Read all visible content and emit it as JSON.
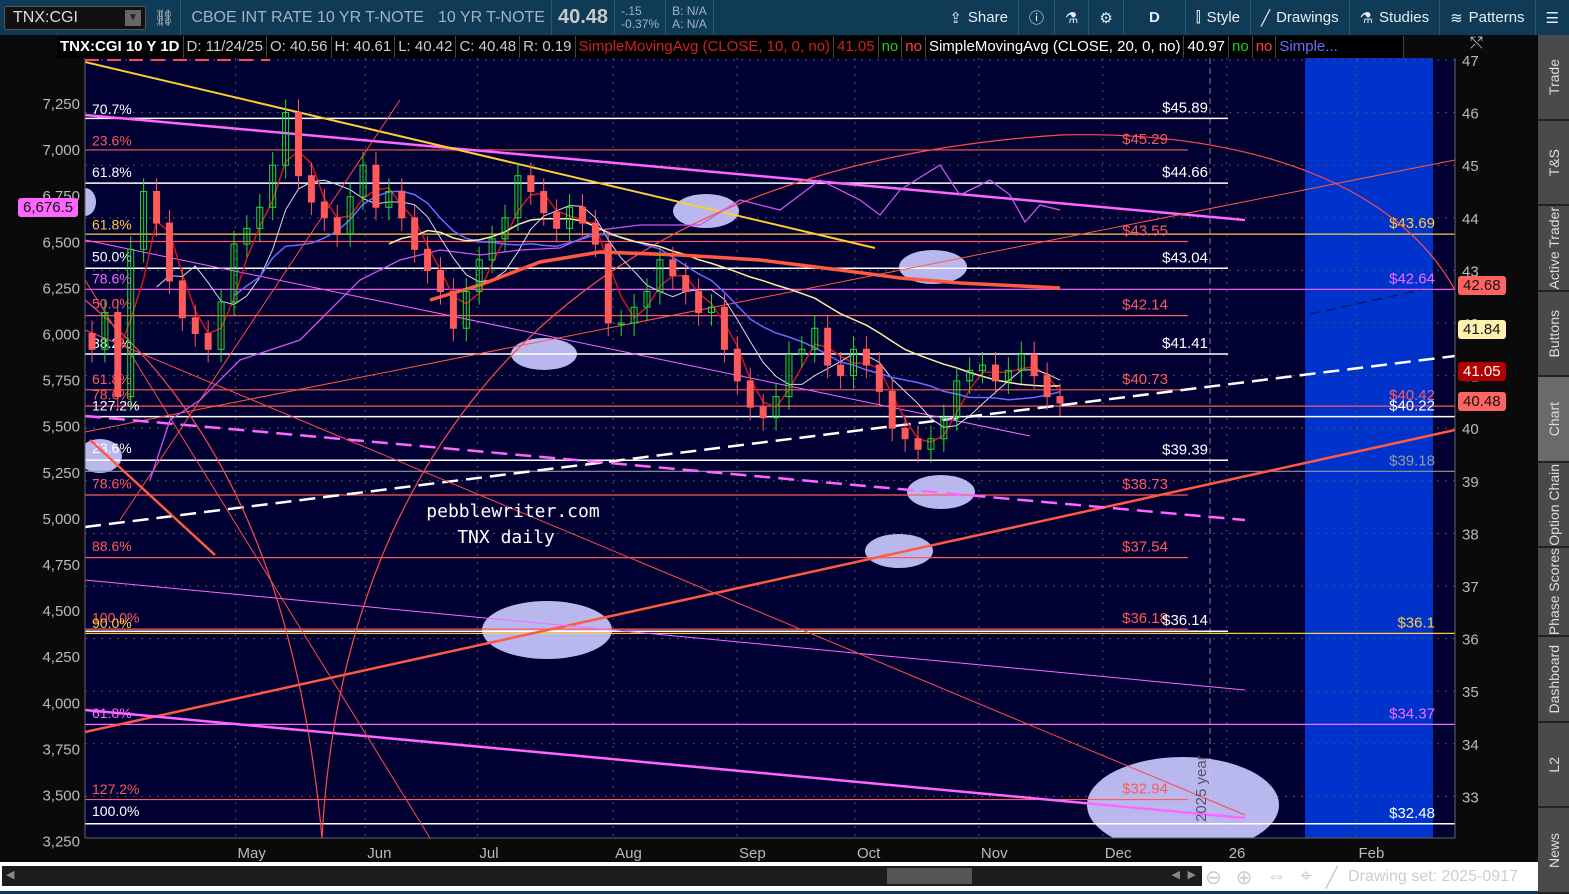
{
  "toolbar": {
    "symbol": "TNX:CGI",
    "description": "CBOE INT RATE 10 YR T-NOTE",
    "short_name": "10 YR T-NOTE",
    "last": "40.48",
    "change": "-.15",
    "change_pct": "-0.37%",
    "bid": "B: N/A",
    "ask": "A: N/A",
    "share": "Share",
    "period": "D",
    "style": "Style",
    "drawings": "Drawings",
    "studies": "Studies",
    "patterns": "Patterns"
  },
  "info": {
    "title": "TNX:CGI 10 Y 1D",
    "date": "D: 11/24/25",
    "open": "O: 40.56",
    "high": "H: 40.61",
    "low": "L: 40.42",
    "close": "C: 40.48",
    "range": "R: 0.19",
    "sma1": "SimpleMovingAvg (CLOSE, 10, 0, no)",
    "sma1_val": "41.05",
    "sma1_a": "no",
    "sma1_b": "no",
    "sma2": "SimpleMovingAvg (CLOSE, 20, 0, no)",
    "sma2_val": "40.97",
    "sma2_a": "no",
    "sma2_b": "no",
    "sma3": "Simple..."
  },
  "colors": {
    "bg": "#000033",
    "white": "#ffffff",
    "red": "#ff5a5a",
    "yellow": "#ffcc33",
    "magenta": "#ff66ff",
    "band": "#0033cc"
  },
  "right_axis": [
    47,
    46,
    45,
    44,
    43,
    42,
    41,
    40,
    39,
    38,
    37,
    36,
    35,
    34,
    33
  ],
  "left_axis": [
    {
      "label": "7,250",
      "v": 7250
    },
    {
      "label": "7,000",
      "v": 7000
    },
    {
      "label": "6,750",
      "v": 6750
    },
    {
      "label": "6,500",
      "v": 6500
    },
    {
      "label": "6,250",
      "v": 6250
    },
    {
      "label": "6,000",
      "v": 6000
    },
    {
      "label": "5,750",
      "v": 5750
    },
    {
      "label": "5,500",
      "v": 5500
    },
    {
      "label": "5,250",
      "v": 5250
    },
    {
      "label": "5,000",
      "v": 5000
    },
    {
      "label": "4,750",
      "v": 4750
    },
    {
      "label": "4,500",
      "v": 4500
    },
    {
      "label": "4,250",
      "v": 4250
    },
    {
      "label": "4,000",
      "v": 4000
    },
    {
      "label": "3,750",
      "v": 3750
    },
    {
      "label": "3,500",
      "v": 3500
    },
    {
      "label": "3,250",
      "v": 3250
    }
  ],
  "months": [
    {
      "label": "May",
      "day": 25
    },
    {
      "label": "Jun",
      "day": 47
    },
    {
      "label": "Jul",
      "day": 66
    },
    {
      "label": "Aug",
      "day": 89
    },
    {
      "label": "Sep",
      "day": 110
    },
    {
      "label": "Oct",
      "day": 130
    },
    {
      "label": "Nov",
      "day": 151
    },
    {
      "label": "Dec",
      "day": 172
    },
    {
      "label": "26",
      "day": 193
    },
    {
      "label": "Feb",
      "day": 215
    }
  ],
  "levels": [
    {
      "p": 45.89,
      "label": "$45.89",
      "c": "white",
      "zone": "a"
    },
    {
      "p": 45.29,
      "label": "$45.29",
      "c": "red",
      "zone": "b"
    },
    {
      "p": 44.66,
      "label": "$44.66",
      "c": "white",
      "zone": "a"
    },
    {
      "p": 43.69,
      "label": "$43.69",
      "c": "yellow",
      "zone": "c"
    },
    {
      "p": 43.55,
      "label": "$43.55",
      "c": "red",
      "zone": "b"
    },
    {
      "p": 43.04,
      "label": "$43.04",
      "c": "white",
      "zone": "a"
    },
    {
      "p": 42.64,
      "label": "$42.64",
      "c": "magenta",
      "zone": "c"
    },
    {
      "p": 42.14,
      "label": "$42.14",
      "c": "red",
      "zone": "b"
    },
    {
      "p": 41.41,
      "label": "$41.41",
      "c": "white",
      "zone": "a"
    },
    {
      "p": 40.73,
      "label": "$40.73",
      "c": "red",
      "zone": "b"
    },
    {
      "p": 40.42,
      "label": "$40.42",
      "c": "red",
      "zone": "c"
    },
    {
      "p": 40.22,
      "label": "$40.22",
      "c": "white",
      "zone": "c"
    },
    {
      "p": 39.39,
      "label": "$39.39",
      "c": "white",
      "zone": "a"
    },
    {
      "p": 39.18,
      "label": "$39.18",
      "c": "gray",
      "zone": "c"
    },
    {
      "p": 38.73,
      "label": "$38.73",
      "c": "red",
      "zone": "b"
    },
    {
      "p": 37.54,
      "label": "$37.54",
      "c": "red",
      "zone": "b"
    },
    {
      "p": 36.18,
      "label": "$36.18",
      "c": "red",
      "zone": "b"
    },
    {
      "p": 36.14,
      "label": "$36.14",
      "c": "white",
      "zone": "a"
    },
    {
      "p": 36.1,
      "label": "$36.1",
      "c": "yellow",
      "zone": "c"
    },
    {
      "p": 34.37,
      "label": "$34.37",
      "c": "magenta",
      "zone": "c"
    },
    {
      "p": 32.94,
      "label": "$32.94",
      "c": "red",
      "zone": "b"
    },
    {
      "p": 32.48,
      "label": "$32.48",
      "c": "white",
      "zone": "c"
    }
  ],
  "fib_labels": [
    {
      "t": "70.7%",
      "c": "white",
      "p": 46.05
    },
    {
      "t": "23.6%",
      "c": "red",
      "p": 45.45
    },
    {
      "t": "61.8%",
      "c": "white",
      "p": 44.85
    },
    {
      "t": "61.8%",
      "c": "yellow",
      "p": 43.85
    },
    {
      "t": "50.0%",
      "c": "white",
      "p": 43.25
    },
    {
      "t": "78.6%",
      "c": "magenta",
      "p": 42.83
    },
    {
      "t": "50.0%",
      "c": "red",
      "p": 42.35
    },
    {
      "t": "38.2%",
      "c": "white",
      "p": 41.6
    },
    {
      "t": "61.8%",
      "c": "red",
      "p": 40.92
    },
    {
      "t": "78.6%",
      "c": "red",
      "p": 40.62
    },
    {
      "t": "127.2%",
      "c": "white",
      "p": 40.41
    },
    {
      "t": "23.6%",
      "c": "white",
      "p": 39.6
    },
    {
      "t": "78.6%",
      "c": "red",
      "p": 38.93
    },
    {
      "t": "88.6%",
      "c": "red",
      "p": 37.74
    },
    {
      "t": "100.0%",
      "c": "red",
      "p": 36.38
    },
    {
      "t": "90.0%",
      "c": "yellow",
      "p": 36.28
    },
    {
      "t": "61.8%",
      "c": "magenta",
      "p": 34.57
    },
    {
      "t": "127.2%",
      "c": "red",
      "p": 33.12
    },
    {
      "t": "100.0%",
      "c": "white",
      "p": 32.7
    }
  ],
  "price_badges": [
    {
      "v": "42.68",
      "p": 42.68,
      "bg": "#ff6464",
      "fg": "#111"
    },
    {
      "v": "41.84",
      "p": 41.84,
      "bg": "#fff0b0",
      "fg": "#111"
    },
    {
      "v": "41.05",
      "p": 41.05,
      "bg": "#b00000",
      "fg": "#fff"
    },
    {
      "v": "40.48",
      "p": 40.48,
      "bg": "#ff6464",
      "fg": "#111"
    }
  ],
  "left_badge": {
    "v": "6,676.5",
    "val": 6676.5
  },
  "watermark": {
    "line1": "pebblewriter.com",
    "line2": "TNX daily"
  },
  "year_marker": "2025 year",
  "closes": [
    41.5,
    42.2,
    40.6,
    43.4,
    44.5,
    43.9,
    42.8,
    42.1,
    41.8,
    41.5,
    42.4,
    43.5,
    43.8,
    44.2,
    45.0,
    46.0,
    44.8,
    44.3,
    44.0,
    43.7,
    44.4,
    45.0,
    44.2,
    44.5,
    44.0,
    43.4,
    43.0,
    42.6,
    41.9,
    42.6,
    43.2,
    43.6,
    44.0,
    44.8,
    44.5,
    44.1,
    43.8,
    44.2,
    43.9,
    43.5,
    42.0,
    42.0,
    42.3,
    42.6,
    43.2,
    42.9,
    42.6,
    42.2,
    42.3,
    41.5,
    40.9,
    40.4,
    40.2,
    40.6,
    41.4,
    41.5,
    41.9,
    41.2,
    41.0,
    41.5,
    41.2,
    40.7,
    40.0,
    39.8,
    39.6,
    39.8,
    40.2,
    40.9,
    41.1,
    41.2,
    40.9,
    41.1,
    41.4,
    41.0,
    40.6,
    40.48
  ],
  "sidebar": [
    "Trade",
    "T&S",
    "Active Trader",
    "Buttons",
    "Chart",
    "Option Chain",
    "Phase Scores",
    "Dashboard",
    "L2",
    "News"
  ],
  "bottom": {
    "drawing_set": "Drawing set: 2025-0917"
  }
}
